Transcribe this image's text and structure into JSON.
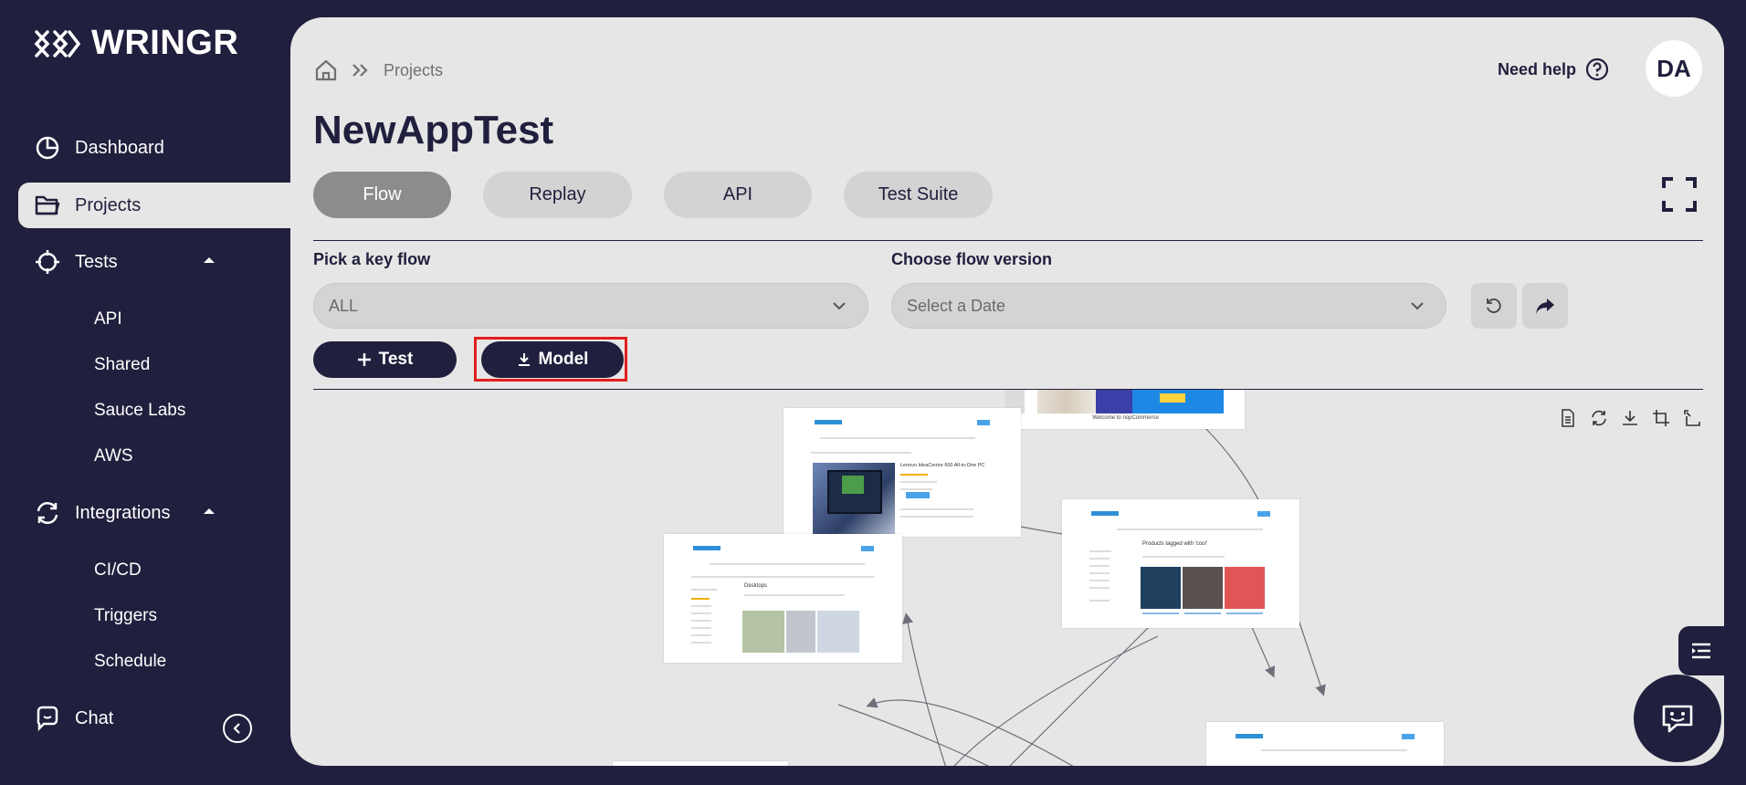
{
  "app": {
    "name": "WRINGR"
  },
  "sidebar": {
    "items": [
      {
        "label": "Dashboard"
      },
      {
        "label": "Projects"
      },
      {
        "label": "Tests"
      },
      {
        "label": "Integrations"
      },
      {
        "label": "Chat"
      }
    ],
    "tests_sub": [
      "API",
      "Shared",
      "Sauce Labs",
      "AWS"
    ],
    "integrations_sub": [
      "CI/CD",
      "Triggers",
      "Schedule"
    ]
  },
  "header": {
    "breadcrumb": "Projects",
    "help_label": "Need help",
    "avatar_initials": "DA"
  },
  "page": {
    "title": "NewAppTest"
  },
  "tabs": [
    "Flow",
    "Replay",
    "API",
    "Test Suite"
  ],
  "filters": {
    "key_flow_label": "Pick a key flow",
    "key_flow_value": "ALL",
    "version_label": "Choose flow version",
    "version_placeholder": "Select a Date"
  },
  "actions": {
    "test_label": "Test",
    "model_label": "Model"
  },
  "colors": {
    "navy": "#201f3d",
    "panel": "#e6e6e6",
    "highlight": "#e31f1f"
  },
  "thumbnails": {
    "top_center_caption": "Welcome to nopCommerce",
    "product_title": "Lenovo IdeaCentre 600 All-in-One PC",
    "categories_title": "Desktops",
    "products_title": "Products tagged with 'cool'",
    "add_to_cart": "Add to cart"
  }
}
